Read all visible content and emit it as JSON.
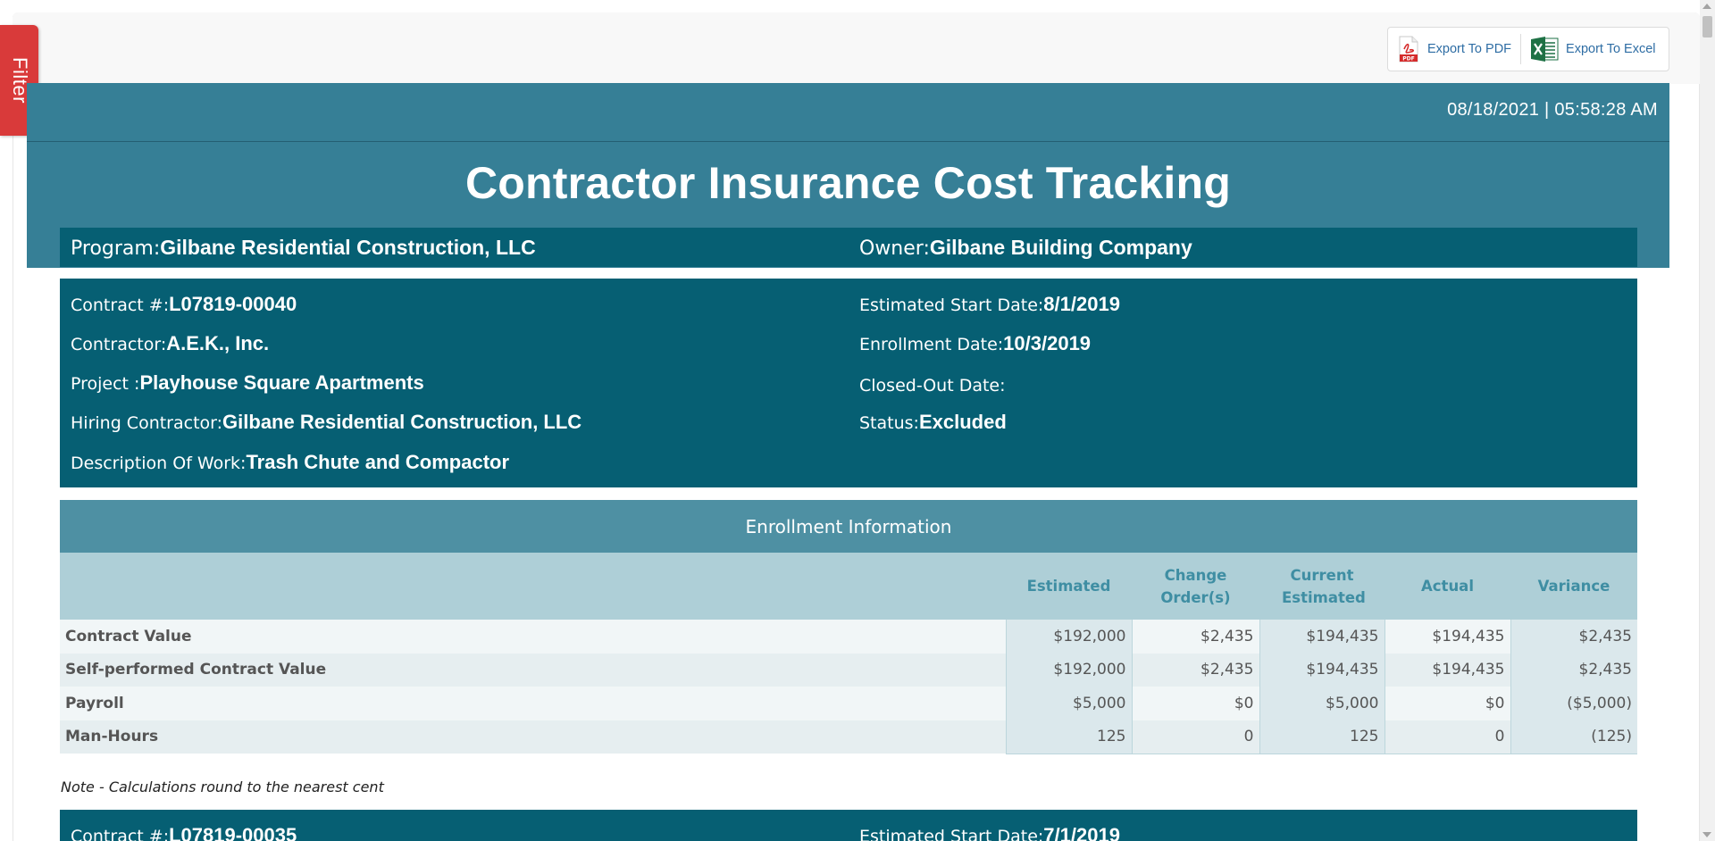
{
  "filter_tab": {
    "label": "Filter"
  },
  "exports": {
    "pdf_label": "Export To PDF",
    "excel_label": "Export To Excel"
  },
  "header": {
    "datetime": "08/18/2021 | 05:58:28 AM",
    "title": "Contractor Insurance Cost Tracking",
    "program_label": "Program:",
    "program_value": "Gilbane Residential Construction, LLC",
    "owner_label": "Owner:",
    "owner_value": "Gilbane Building Company"
  },
  "contracts": [
    {
      "contract_no_label": "Contract #:",
      "contract_no": "L07819-00040",
      "contractor_label": "Contractor:",
      "contractor": "A.E.K., Inc.",
      "project_label": "Project :",
      "project": "Playhouse Square Apartments",
      "hiring_label": "Hiring Contractor:",
      "hiring": "Gilbane Residential Construction, LLC",
      "description_label": "Description Of Work:",
      "description": "Trash Chute and Compactor",
      "start_label": "Estimated Start Date:",
      "start": "8/1/2019",
      "enroll_label": "Enrollment Date:",
      "enroll": "10/3/2019",
      "closed_label": "Closed-Out Date:",
      "closed": "",
      "status_label": "Status:",
      "status": "Excluded"
    },
    {
      "contract_no_label": "Contract #:",
      "contract_no": "L07819-00035",
      "start_label": "Estimated Start Date:",
      "start": "7/1/2019"
    }
  ],
  "enrollment": {
    "title": "Enrollment Information",
    "columns": [
      "Estimated",
      "Change Order(s)",
      "Current Estimated",
      "Actual",
      "Variance"
    ],
    "rows": [
      {
        "label": "Contract Value",
        "values": [
          "$192,000",
          "$2,435",
          "$194,435",
          "$194,435",
          "$2,435"
        ]
      },
      {
        "label": "Self-performed Contract Value",
        "values": [
          "$192,000",
          "$2,435",
          "$194,435",
          "$194,435",
          "$2,435"
        ]
      },
      {
        "label": "Payroll",
        "values": [
          "$5,000",
          "$0",
          "$5,000",
          "$0",
          "($5,000)"
        ]
      },
      {
        "label": "Man-Hours",
        "values": [
          "125",
          "0",
          "125",
          "0",
          "(125)"
        ]
      }
    ]
  },
  "note": "Note - Calculations round to the nearest cent",
  "colors": {
    "header_teal": "#367f96",
    "panel_teal": "#065f73",
    "section_teal": "#4e90a3",
    "filter_red": "#d93a3a"
  },
  "icons": {
    "pdf": "pdf-file-icon",
    "excel": "excel-file-icon"
  }
}
